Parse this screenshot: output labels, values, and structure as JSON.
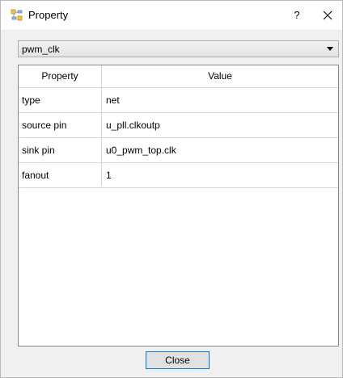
{
  "window": {
    "title": "Property",
    "help_label": "?",
    "app_icon": "property-icon",
    "close_icon": "close-icon"
  },
  "combo": {
    "selected": "pwm_clk"
  },
  "table": {
    "headers": [
      "Property",
      "Value"
    ],
    "rows": [
      {
        "property": "type",
        "value": "net"
      },
      {
        "property": "source pin",
        "value": "u_pll.clkoutp"
      },
      {
        "property": "sink pin",
        "value": "u0_pwm_top.clk"
      },
      {
        "property": "fanout",
        "value": "1"
      }
    ]
  },
  "footer": {
    "close_label": "Close"
  },
  "colors": {
    "accent": "#0078d7",
    "border": "#828790",
    "grid": "#d5d5d5"
  }
}
